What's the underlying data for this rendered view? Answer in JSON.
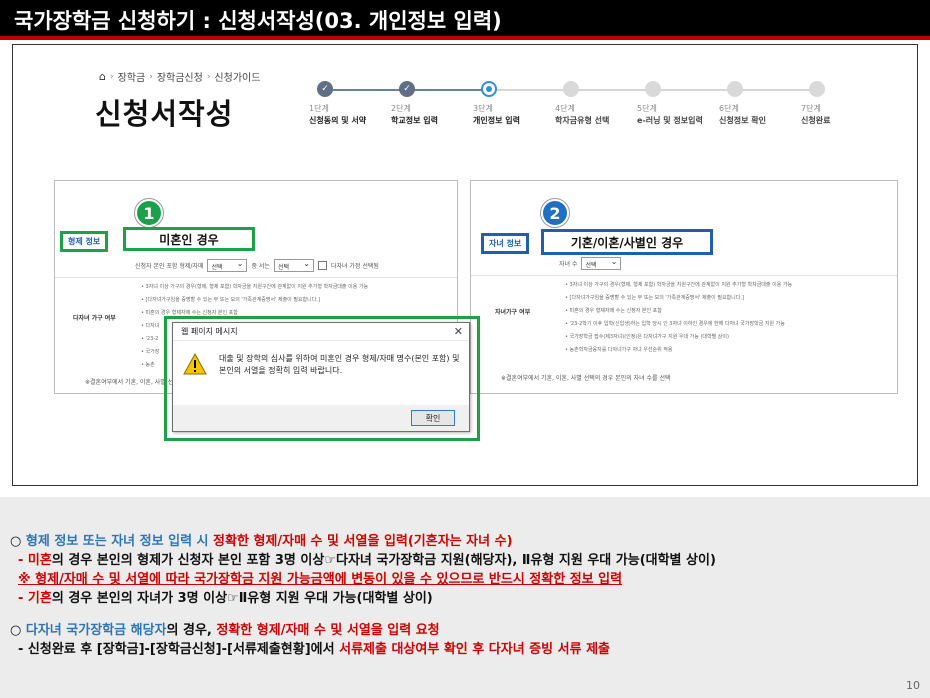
{
  "slide_title": "국가장학금 신청하기 : 신청서작성(03. 개인정보 입력)",
  "page_number": "10",
  "breadcrumb": {
    "home_icon": "home-icon",
    "items": [
      "장학금",
      "장학금신청",
      "신청가이드"
    ]
  },
  "page_heading": "신청서작성",
  "stepper": {
    "steps": [
      {
        "num": "1단계",
        "name": "신청동의 및 서약",
        "state": "done"
      },
      {
        "num": "2단계",
        "name": "학교정보 입력",
        "state": "done"
      },
      {
        "num": "3단계",
        "name": "개인정보 입력",
        "state": "current"
      },
      {
        "num": "4단계",
        "name": "학자금유형 선택",
        "state": "todo"
      },
      {
        "num": "5단계",
        "name": "e-러닝 및 정보입력",
        "state": "todo"
      },
      {
        "num": "6단계",
        "name": "신청정보 확인",
        "state": "todo"
      },
      {
        "num": "7단계",
        "name": "신청완료",
        "state": "todo"
      }
    ]
  },
  "panel_left": {
    "badge": "1",
    "tag": "형제 정보",
    "case_label": "미혼인 경우",
    "row_label": "신청자 본인 포함 형제/자매",
    "select_1": "선택",
    "order_label": "중 서는",
    "select_2": "선택",
    "check_label": "다자녀 가정 선택됨",
    "side_label": "다자녀 가구 여부",
    "notes": [
      "3자녀 이상 가구의 경우(형제, 형제 포함) 학자금을 지원구간에 관계없이 지원 추가형 학자금대출 이용 가능",
      "[다자녀가구임을 증명할 수 있는 부 또는 모의 '가족관계증명서' 제출이 필요합니다.]",
      "미혼의 경우 형제자매 수는 신청자 본인 포함",
      "다자녀",
      "'23-2",
      "국가장",
      "농촌"
    ],
    "footnote": "※결혼여부에서 기혼, 이혼, 사별 선"
  },
  "panel_right": {
    "badge": "2",
    "tag": "자녀 정보",
    "case_label": "기혼/이혼/사별인 경우",
    "row_label": "자녀 수",
    "select_1": "선택",
    "side_label": "자녀가구 여부",
    "notes": [
      "3자녀 이상 가구의 경우(형제, 형제 포함) 학자금을 지원구간에 관계없이 지원 추가형 학자금대출 이용 가능",
      "[다자녀가구임을 증명할 수 있는 부 또는 모의 '가족관계증명서' 제출이 필요합니다.]",
      "미혼의 경우 형제자매 수는 신청자 본인 포함",
      "'23-2학기 이후 입학(신입생)하는 입학 당시 인 3자녀 이하인 경우에 한해 다자녀 국가장학금 지원 가능",
      "국가장학금 접수(제3자녀)(인정)은 다자녀가구 지원 우대 가능 (대학별 상이)",
      "농촌학자금융자를 다자녀가구 자녀 우선순위 적용"
    ],
    "footnote": "※결혼여부에서 기혼, 이혼, 사별 선택의 경우 본인의 자녀 수를 선택"
  },
  "dialog": {
    "title": "웹 페이지 메시지",
    "message": "대출 및 장학의 심사를 위하여 미혼인 경우 형제/자매 명수(본인 포함) 및 본인의 서열을 정확히 입력 바랍니다.",
    "ok_label": "확인",
    "icon": "warning-icon"
  },
  "explanation": {
    "block1_head_prefix": "○ ",
    "block1_head_blue": "형제 정보 또는 자녀 정보 입력 시",
    "block1_head_red": " 정확한 형제/자매 수 및 서열을 입력(기혼자는 자녀 수)",
    "line2_red": "- 미혼",
    "line2_rest": "의 경우 본인의 형제가 신청자 본인 포함 3명 이상☞다자녀 국가장학금 지원(해당자), Ⅱ유형 지원 우대 가능(대학별 상이)",
    "line3_red": "※ 형제/자매 수 및 서열에 따라 국가장학금 지원 가능금액에 변동이 있을 수 있으므로 반드시 정확한 정보 입력",
    "line4_red": "- 기혼",
    "line4_rest": "의 경우 본인의 자녀가 3명 이상☞Ⅱ유형 지원 우대 가능(대학별 상이)",
    "block2_head_prefix": "○ ",
    "block2_head_blue": "다자녀 국가장학금 해당자",
    "block2_head_mid": "의 경우, ",
    "block2_head_red": "정확한 형제/자매 수 및 서열을 입력 요청",
    "line6_prefix": "- 신청완료 후 [장학금]-[장학금신청]-[서류제출현황]에서 ",
    "line6_red": "서류제출 대상여부 확인 후 다자녀 증빙 서류 제출"
  },
  "colors": {
    "title_bg": "#000000",
    "title_rule": "#c00000",
    "highlight_green": "#1aa14a",
    "highlight_blue": "#1f5fb2",
    "text_blue": "#2e75b6",
    "text_red": "#d00000"
  }
}
